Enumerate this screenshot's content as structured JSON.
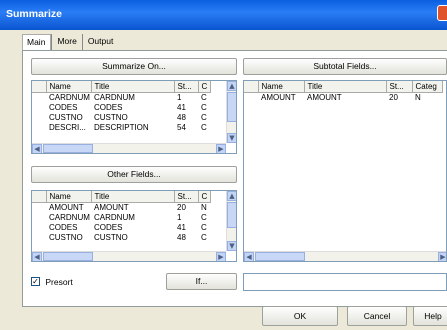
{
  "window": {
    "title": "Summarize"
  },
  "tabs": [
    {
      "label": "Main"
    },
    {
      "label": "More"
    },
    {
      "label": "Output"
    }
  ],
  "summarize_on": {
    "button": "Summarize On...",
    "columns": [
      "Name",
      "Title",
      "St...",
      "C"
    ],
    "rows": [
      [
        "CARDNUM",
        "CARDNUM",
        "1",
        "C"
      ],
      [
        "CODES",
        "CODES",
        "41",
        "C"
      ],
      [
        "CUSTNO",
        "CUSTNO",
        "48",
        "C"
      ],
      [
        "DESCRI...",
        "DESCRIPTION",
        "54",
        "C"
      ]
    ]
  },
  "other_fields": {
    "button": "Other Fields...",
    "columns": [
      "Name",
      "Title",
      "St...",
      "C"
    ],
    "rows": [
      [
        "AMOUNT",
        "AMOUNT",
        "20",
        "N"
      ],
      [
        "CARDNUM",
        "CARDNUM",
        "1",
        "C"
      ],
      [
        "CODES",
        "CODES",
        "41",
        "C"
      ],
      [
        "CUSTNO",
        "CUSTNO",
        "48",
        "C"
      ]
    ]
  },
  "subtotal_fields": {
    "button": "Subtotal Fields...",
    "columns": [
      "Name",
      "Title",
      "St...",
      "Categ"
    ],
    "rows": [
      [
        "AMOUNT",
        "AMOUNT",
        "20",
        "N"
      ]
    ]
  },
  "presort": {
    "label": "Presort",
    "checked": true
  },
  "if_button": "If...",
  "buttons": {
    "ok": "OK",
    "cancel": "Cancel",
    "help": "Help"
  }
}
